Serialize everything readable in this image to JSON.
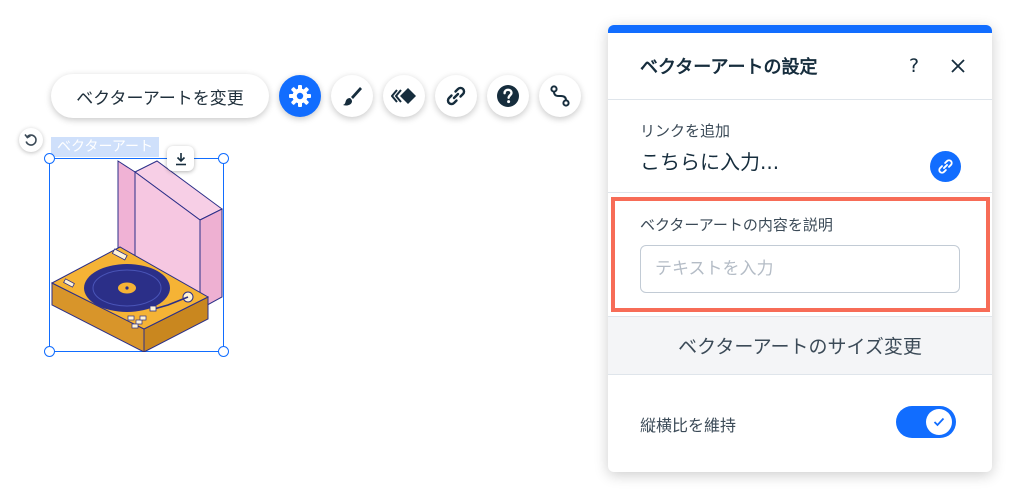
{
  "toolbar": {
    "change_label": "ベクターアートを変更",
    "buttons": [
      {
        "icon": "gear-icon",
        "active": true
      },
      {
        "icon": "paintbrush-icon"
      },
      {
        "icon": "animation-icon"
      },
      {
        "icon": "link-icon"
      },
      {
        "icon": "help-icon"
      },
      {
        "icon": "path-connect-icon"
      }
    ]
  },
  "canvas": {
    "element_label": "ベクターアート",
    "icons": [
      "rotate-icon",
      "download-icon"
    ]
  },
  "panel": {
    "title": "ベクターアートの設定",
    "help_label": "?",
    "link": {
      "label": "リンクを追加",
      "value": "こちらに入力..."
    },
    "alt_text": {
      "label": "ベクターアートの内容を説明",
      "placeholder": "テキストを入力"
    },
    "resize_label": "ベクターアートのサイズ変更",
    "aspect_ratio": {
      "label": "縦横比を維持",
      "enabled": true
    }
  },
  "colors": {
    "accent": "#116dff",
    "highlight_border": "#f76c57",
    "art_yellow": "#f5b335",
    "art_navy": "#2b2f88",
    "art_pink": "#f6c7e1"
  }
}
